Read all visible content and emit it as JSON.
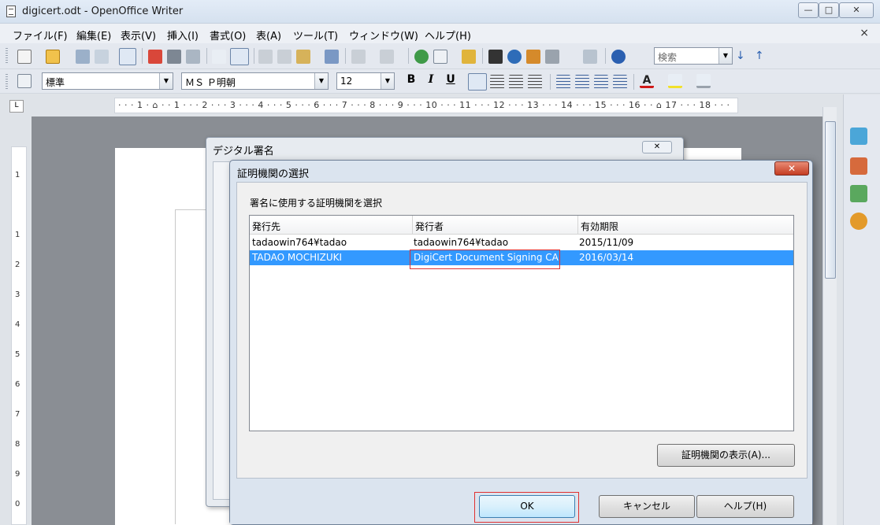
{
  "window": {
    "title": "digicert.odt - OpenOffice Writer",
    "minimize": "—",
    "maximize": "□",
    "close": "✕",
    "doc_close": "×"
  },
  "menu": [
    "ファイル(F)",
    "編集(E)",
    "表示(V)",
    "挿入(I)",
    "書式(O)",
    "表(A)",
    "ツール(T)",
    "ウィンドウ(W)",
    "ヘルプ(H)"
  ],
  "toolbar": {
    "search_placeholder": "検索",
    "style_value": "標準",
    "font_value": "ＭＳ Ｐ明朝",
    "size_value": "12",
    "bold": "B",
    "italic": "I",
    "underline": "U"
  },
  "ruler": {
    "corner": "L",
    "horizontal": "· · · 1 · ⌂ · · 1 · · · 2 · · · 3 · · · 4 · · · 5 · · · 6 · · · 7 · · · 8 · · · 9 · · · 10 · · · 11 · · · 12 · · · 13 · · · 14 · · · 15 · · · 16 · · ⌂ 17 · · · 18 · · ·",
    "vertical": [
      "1",
      "1",
      "2",
      "3",
      "4",
      "5",
      "6",
      "7",
      "8",
      "9",
      "0"
    ]
  },
  "bg_dialog": {
    "title": "デジタル署名",
    "close": "✕"
  },
  "dialog": {
    "title": "証明機関の選択",
    "close": "✕",
    "prompt": "署名に使用する証明機関を選択",
    "columns": [
      "発行先",
      "発行者",
      "有効期限"
    ],
    "rows": [
      {
        "issued_to": "tadaowin764¥tadao",
        "issuer": "tadaowin764¥tadao",
        "expires": "2015/11/09"
      },
      {
        "issued_to": "TADAO MOCHIZUKI",
        "issuer": "DigiCert Document Signing CA",
        "expires": "2016/03/14"
      }
    ],
    "view_cert_button": "証明機関の表示(A)...",
    "ok_button": "OK",
    "cancel_button": "キャンセル",
    "help_button": "ヘルプ(H)"
  },
  "colors": {
    "selection": "#3399ff",
    "highlight_box": "#e03030",
    "close_button": "#c43d22"
  }
}
